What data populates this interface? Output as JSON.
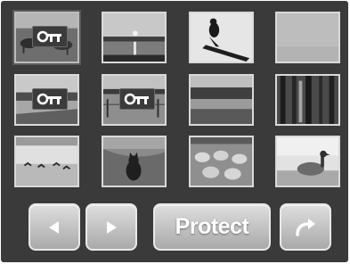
{
  "gallery": {
    "thumbnails": [
      {
        "name": "thumb-cows-field",
        "scene": "cows",
        "protected": true,
        "selected": true
      },
      {
        "name": "thumb-lake-sunset",
        "scene": "lake-sunset",
        "protected": false,
        "selected": false
      },
      {
        "name": "thumb-person-on-log",
        "scene": "person-log",
        "protected": false,
        "selected": false
      },
      {
        "name": "thumb-blank-sky",
        "scene": "blank",
        "protected": false,
        "selected": false
      },
      {
        "name": "thumb-river-landscape",
        "scene": "river",
        "protected": true,
        "selected": false
      },
      {
        "name": "thumb-pasture-fence",
        "scene": "pasture",
        "protected": true,
        "selected": false
      },
      {
        "name": "thumb-lake-reflection",
        "scene": "lake-reflection",
        "protected": false,
        "selected": false
      },
      {
        "name": "thumb-forest-trees",
        "scene": "forest",
        "protected": false,
        "selected": false
      },
      {
        "name": "thumb-birds-shore",
        "scene": "birds",
        "protected": false,
        "selected": false
      },
      {
        "name": "thumb-cat-grass",
        "scene": "cat",
        "protected": false,
        "selected": false
      },
      {
        "name": "thumb-sheep-flock",
        "scene": "sheep",
        "protected": false,
        "selected": false
      },
      {
        "name": "thumb-goose-shore",
        "scene": "goose",
        "protected": false,
        "selected": false
      }
    ]
  },
  "toolbar": {
    "prev_icon": "triangle-left-icon",
    "next_icon": "triangle-right-icon",
    "protect_label": "Protect",
    "return_icon": "return-arrow-icon"
  },
  "colors": {
    "background": "#3a3a3a",
    "button_top": "#dedede",
    "button_bottom": "#a9a9a9",
    "thumb_border": "#d9d9d9"
  }
}
